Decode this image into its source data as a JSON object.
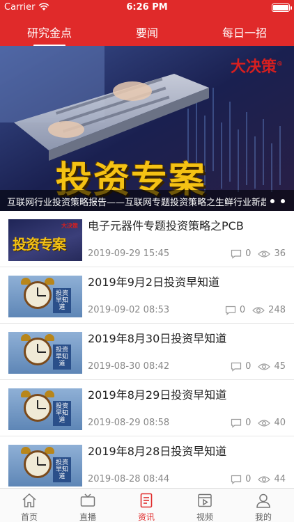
{
  "status_bar": {
    "carrier": "Carrier",
    "time": "6:26 PM"
  },
  "top_tabs": [
    {
      "label": "研究金点",
      "active": true
    },
    {
      "label": "要闻",
      "active": false
    },
    {
      "label": "每日一招",
      "active": false
    }
  ],
  "banner": {
    "brand": "大决策",
    "brand_mark": "®",
    "headline": "投资专案",
    "caption": "互联网行业投资策略报告——互联网专题投资策略之生鲜行业新趋势",
    "pages": 2
  },
  "news": [
    {
      "title": "电子元器件专题投资策略之PCB",
      "date": "2019-09-29 15:45",
      "comments": "0",
      "views": "36",
      "thumb": "invest",
      "thumb_text": "投资专案",
      "thumb_brand": "大决策"
    },
    {
      "title": "2019年9月2日投资早知道",
      "date": "2019-09-02 08:53",
      "comments": "0",
      "views": "248",
      "thumb": "clock",
      "thumb_tag": "投资 早知道"
    },
    {
      "title": "2019年8月30日投资早知道",
      "date": "2019-08-30 08:42",
      "comments": "0",
      "views": "45",
      "thumb": "clock",
      "thumb_tag": "投资 早知道"
    },
    {
      "title": "2019年8月29日投资早知道",
      "date": "2019-08-29 08:58",
      "comments": "0",
      "views": "40",
      "thumb": "clock",
      "thumb_tag": "投资 早知道"
    },
    {
      "title": "2019年8月28日投资早知道",
      "date": "2019-08-28 08:44",
      "comments": "0",
      "views": "44",
      "thumb": "clock",
      "thumb_tag": "投资 早知道"
    }
  ],
  "bottom_tabs": [
    {
      "label": "首页",
      "icon": "home-icon",
      "active": false
    },
    {
      "label": "直播",
      "icon": "tv-icon",
      "active": false
    },
    {
      "label": "资讯",
      "icon": "document-icon",
      "active": true
    },
    {
      "label": "视频",
      "icon": "video-icon",
      "active": false
    },
    {
      "label": "我的",
      "icon": "user-icon",
      "active": false
    }
  ],
  "colors": {
    "accent": "#e02a2a",
    "headline_gold": "#f5c214",
    "meta_gray": "#888888"
  }
}
